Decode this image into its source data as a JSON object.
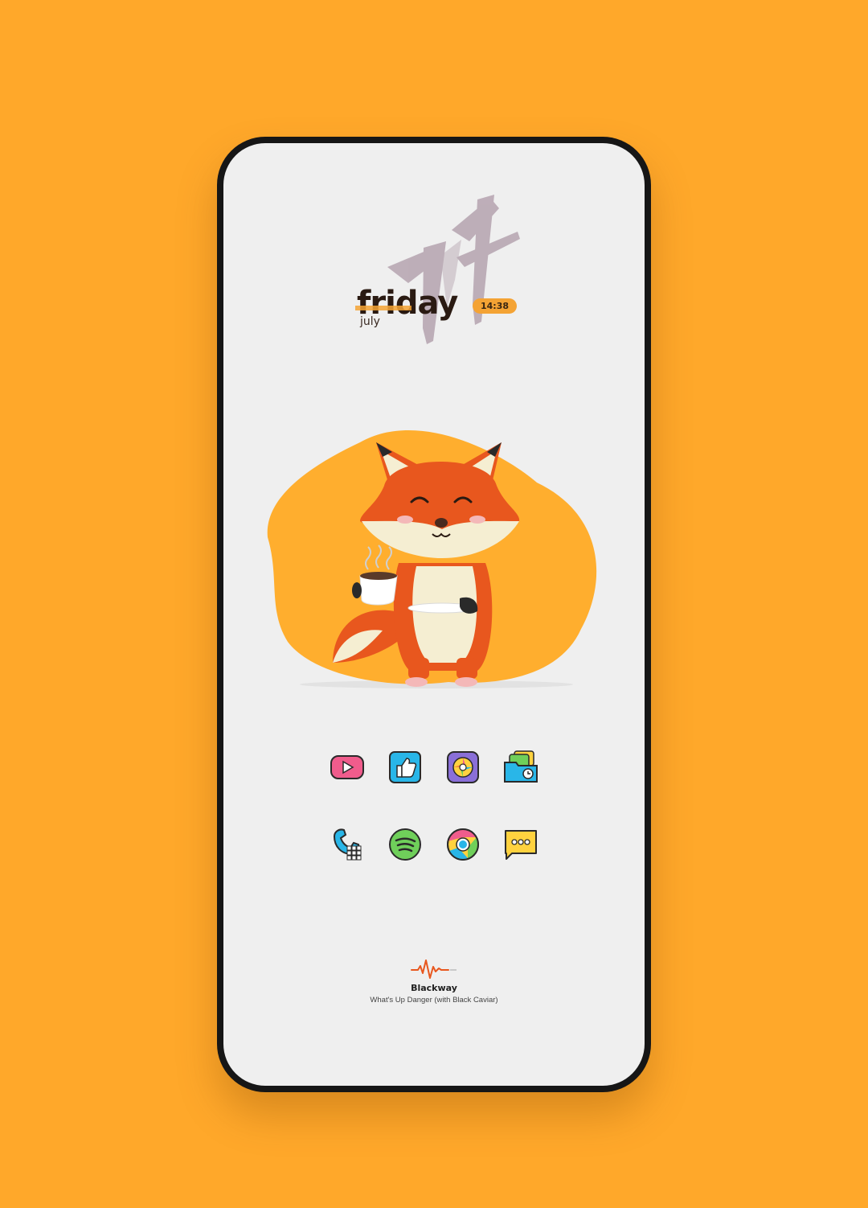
{
  "clock": {
    "date_numeral": "17",
    "day_name": "friday",
    "month": "july",
    "time": "14:38"
  },
  "colors": {
    "background": "#FFA82A",
    "accent": "#F4A334",
    "fox_orange": "#E8571E",
    "date_brush": "#B8A7B3"
  },
  "apps": {
    "row1": [
      {
        "name": "youtube-icon"
      },
      {
        "name": "thumbs-up-icon"
      },
      {
        "name": "camera-aperture-icon"
      },
      {
        "name": "file-manager-icon"
      }
    ],
    "row2": [
      {
        "name": "phone-dialer-icon"
      },
      {
        "name": "spotify-icon"
      },
      {
        "name": "chrome-icon"
      },
      {
        "name": "messages-icon"
      }
    ]
  },
  "music": {
    "artist": "Blackway",
    "track": "What's Up Danger (with Black Caviar)",
    "icon": "sound-wave-icon"
  }
}
